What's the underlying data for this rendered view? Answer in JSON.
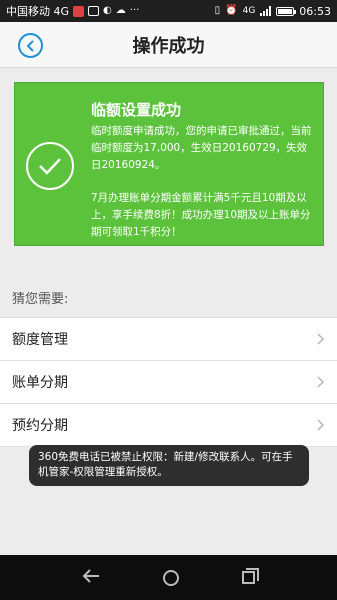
{
  "status_bar": {
    "carrier": "中国移动 4G",
    "time": "06:53",
    "network": "4G",
    "battery_level": 1.0
  },
  "header": {
    "title": "操作成功",
    "back_icon": "chevron-left-icon"
  },
  "card": {
    "heading": "临额设置成功",
    "message": "临时额度申请成功，您的申请已审批通过，当前临时额度为17,000，生效日20160729，失效日20160924。",
    "promo": "7月办理账单分期金额累计满5千元且10期及以上，享手续费8折！成功办理10期及以上账单分期可领取1千积分！",
    "accent_color": "#5cc23c"
  },
  "guess": {
    "title": "猜您需要:"
  },
  "list": {
    "items": [
      {
        "label": "额度管理"
      },
      {
        "label": "账单分期"
      },
      {
        "label": "预约分期"
      }
    ]
  },
  "toast": {
    "text": "360免费电话已被禁止权限：新建/修改联系人。可在手机管家-权限管理重新授权。"
  }
}
